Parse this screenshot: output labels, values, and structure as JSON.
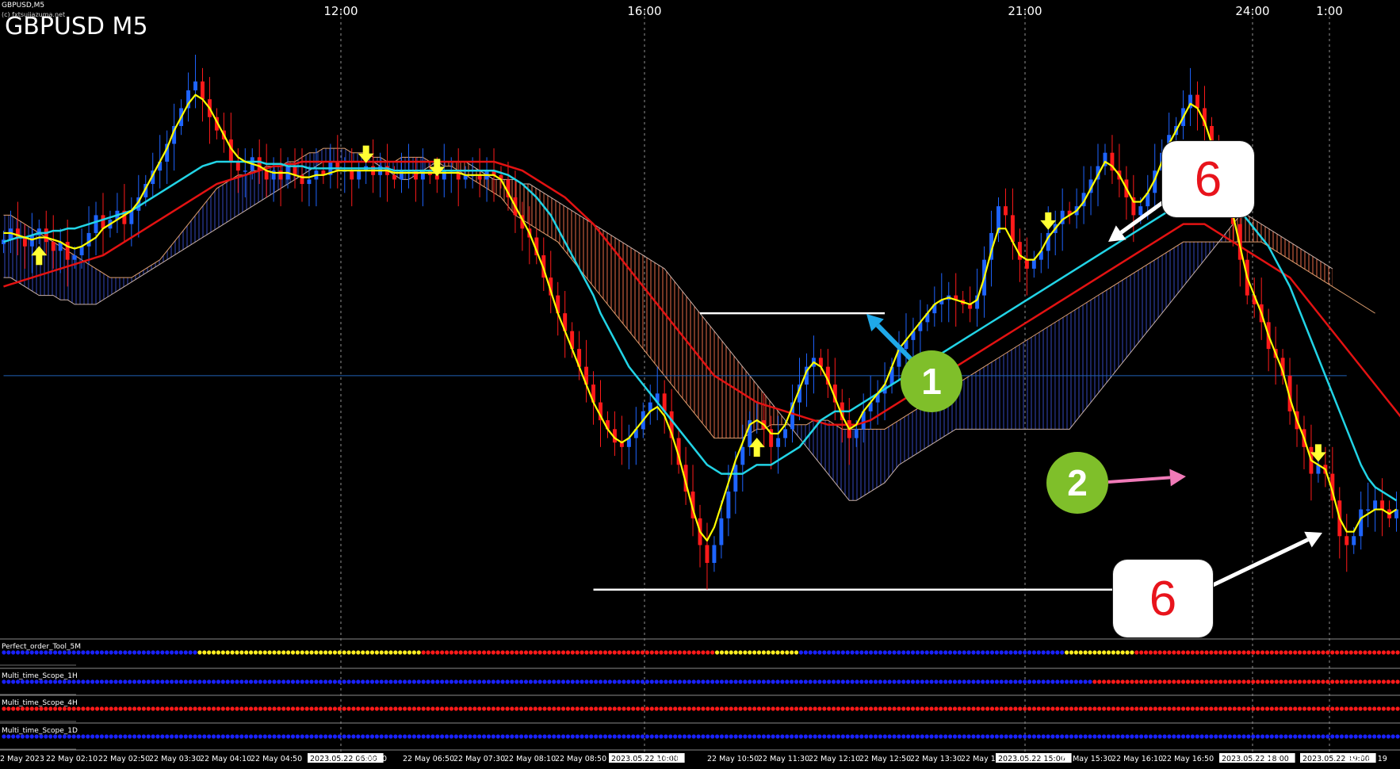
{
  "header": {
    "symbol_small": "GBPUSD,M5",
    "copyright": "(c) fxtsujiazuma.net",
    "title": "GBPUSD M5"
  },
  "time_axis_top": [
    "12:00",
    "16:00",
    "21:00",
    "24:00",
    "1:00"
  ],
  "time_axis_bottom": [
    "2 May 2023",
    "22 May 02:10",
    "22 May 02:50",
    "22 May 03:30",
    "22 May 04:10",
    "22 May 04:50",
    "2023.05.22 06:00",
    "y 06:10",
    "22 May 06:50",
    "22 May 07:30",
    "22 May 08:10",
    "22 May 08:50",
    "2023.05.22 10:00",
    "y 10:10",
    "22 May 10:50",
    "22 May 11:30",
    "22 May 12:10",
    "22 May 12:50",
    "22 May 13:30",
    "22 May 1",
    "2023.05.22 15:00",
    "22 May 15:30",
    "22 May 16:10",
    "22 May 16:50",
    "2023.05.22 18:00",
    "y 1",
    "2023.05.22 19:00",
    "22 May 19"
  ],
  "annotations": {
    "box_top": "6",
    "box_bottom": "6",
    "circle_1": "1",
    "circle_2": "2"
  },
  "subwindows": [
    {
      "name": "Perfect_order_Tool_5M",
      "dots": [
        [
          "blue",
          0.14
        ],
        [
          "yellow",
          0.16
        ],
        [
          "red",
          0.21
        ],
        [
          "yellow",
          0.06
        ],
        [
          "blue",
          0.19
        ],
        [
          "yellow",
          0.05
        ],
        [
          "red",
          0.19
        ]
      ]
    },
    {
      "name": "Multi_time_Scope_1H",
      "dots": [
        [
          "blue",
          0.78
        ],
        [
          "red",
          0.22
        ]
      ]
    },
    {
      "name": "Multi_time_Scope_4H",
      "dots": [
        [
          "red",
          1.0
        ]
      ]
    },
    {
      "name": "Multi_time_Scope_1D",
      "dots": [
        [
          "blue",
          1.0
        ]
      ]
    }
  ],
  "colors": {
    "background": "#000000",
    "bull_candle": "#1e64ff",
    "bear_candle": "#ff1a1a",
    "ma_fast": "#ffff00",
    "ma_mid": "#22d4e6",
    "ma_slow": "#e31212",
    "cloud_bull": "#2c3c9c",
    "cloud_bear": "#c05a3c",
    "signal_arrow": "#ffff33",
    "callout_red": "#e8141c",
    "callout_green": "#7fbf2a"
  },
  "chart_data": {
    "type": "candlestick",
    "symbol": "GBPUSD",
    "timeframe": "M5",
    "close": [
      30.5,
      33,
      31,
      29,
      31.5,
      33,
      30,
      28,
      30,
      26,
      27,
      29,
      32,
      36,
      33,
      35,
      37,
      34,
      37,
      40,
      43,
      46,
      48,
      52,
      56,
      60,
      64,
      66,
      62,
      58,
      55,
      53,
      48,
      46,
      46,
      49,
      46,
      44,
      46,
      44,
      47,
      45,
      43,
      44,
      46,
      45,
      48,
      46,
      46,
      44,
      46,
      47,
      45,
      47,
      45,
      44,
      46,
      46,
      44,
      46,
      45,
      44,
      46,
      46,
      44,
      45,
      45,
      44,
      46,
      45,
      44,
      40,
      36,
      33,
      31,
      27,
      22,
      18,
      14,
      10,
      6,
      2,
      -2,
      -6,
      -10,
      -12,
      -15,
      -16,
      -14,
      -12,
      -8,
      -6,
      -4,
      -8,
      -14,
      -20,
      -26,
      -32,
      -38,
      -42,
      -38,
      -32,
      -26,
      -20,
      -16,
      -10,
      -10,
      -12,
      -16,
      -14,
      -12,
      -6,
      -2,
      2,
      4,
      2,
      -2,
      -6,
      -10,
      -14,
      -12,
      -8,
      -6,
      -4,
      -2,
      2,
      6,
      8,
      10,
      12,
      14,
      16,
      17,
      18,
      17,
      16,
      15,
      18,
      26,
      32,
      38,
      36,
      30,
      26,
      24,
      26,
      28,
      32,
      34,
      37,
      36,
      38,
      41,
      44,
      47,
      50,
      46,
      44,
      40,
      36,
      38,
      41,
      46,
      50,
      54,
      56,
      60,
      63,
      60,
      56,
      50,
      44,
      40,
      34,
      26,
      18,
      16,
      12,
      6,
      4,
      0,
      -8,
      -12,
      -16,
      -22,
      -20,
      -22,
      -28,
      -36,
      -38,
      -36,
      -30,
      -30,
      -28,
      -30,
      -32,
      -30
    ],
    "ma_fast": [
      32,
      32,
      31.5,
      31,
      30.5,
      31,
      31,
      30.5,
      30,
      29,
      28.5,
      29,
      30,
      31,
      33,
      34,
      35,
      36,
      37,
      39,
      42,
      45,
      48,
      51,
      55,
      58,
      61,
      63,
      62,
      60,
      57,
      54,
      51,
      49,
      48,
      47.5,
      47,
      46,
      45.5,
      45.5,
      45.5,
      45,
      44.5,
      44.5,
      45,
      45,
      45.5,
      46,
      46,
      46,
      46,
      46,
      46,
      46,
      46,
      45.5,
      45.5,
      45.5,
      45.5,
      45.5,
      45.5,
      45.5,
      45.5,
      45.5,
      45.5,
      45,
      45,
      45,
      45,
      45,
      44,
      41,
      38,
      35,
      32,
      28,
      24,
      19,
      14,
      10,
      6,
      2,
      -2,
      -6,
      -9,
      -12,
      -14,
      -15,
      -14,
      -12,
      -10,
      -8,
      -7,
      -9,
      -13,
      -18,
      -24,
      -30,
      -35,
      -37,
      -34,
      -29,
      -24,
      -19,
      -15,
      -11,
      -10,
      -11,
      -13,
      -13,
      -11,
      -7,
      -3,
      1,
      3,
      2,
      -1,
      -5,
      -9,
      -12,
      -11,
      -8,
      -6,
      -4,
      -2,
      2,
      6,
      8,
      10,
      12,
      14,
      16,
      17,
      17.5,
      17,
      16.5,
      16,
      17,
      22,
      28,
      33,
      33,
      30,
      27,
      26,
      26,
      28,
      31,
      33,
      35,
      36,
      37,
      39,
      42,
      45,
      48,
      47,
      45,
      42,
      39,
      39,
      41,
      44,
      48,
      52,
      55,
      58,
      61,
      60,
      57,
      52,
      46,
      41,
      36,
      29,
      22,
      18,
      14,
      9,
      5,
      1,
      -5,
      -10,
      -14,
      -19,
      -20,
      -21,
      -26,
      -32,
      -35,
      -35,
      -32,
      -31,
      -30,
      -30,
      -31,
      -30
    ],
    "ma_mid": [
      30,
      30.5,
      31,
      31,
      31.5,
      32,
      32,
      32.5,
      32.5,
      33,
      33,
      33.5,
      34,
      34.5,
      35,
      35.5,
      36,
      36.5,
      37,
      38,
      39,
      40,
      41,
      42,
      43,
      44,
      45,
      46,
      47,
      47.5,
      48,
      48,
      48,
      48,
      48,
      48,
      48,
      47.5,
      47.5,
      47.5,
      47,
      47,
      47,
      46.5,
      46.5,
      46.5,
      46.5,
      46.5,
      46.5,
      46.5,
      46.5,
      46.5,
      46.5,
      46.5,
      46.5,
      46,
      46,
      46,
      46,
      46,
      46,
      46,
      46,
      46,
      46,
      46,
      46,
      46,
      46,
      46,
      45.5,
      45,
      44,
      43,
      41.5,
      40,
      38,
      36,
      33,
      30,
      27,
      24,
      21,
      18,
      14,
      11,
      8,
      5,
      2,
      0,
      -2,
      -4,
      -6,
      -8,
      -10,
      -12,
      -14,
      -16,
      -18,
      -20,
      -21,
      -22,
      -22,
      -22,
      -22,
      -21,
      -20,
      -20,
      -20,
      -19,
      -18,
      -17,
      -16,
      -14,
      -12,
      -10,
      -9,
      -8,
      -8,
      -8,
      -7,
      -6,
      -5,
      -4,
      -3,
      -2,
      -1,
      0,
      1,
      2,
      3,
      4,
      5,
      6,
      7,
      8,
      9,
      10,
      11,
      12,
      13,
      14,
      15,
      16,
      17,
      18,
      19,
      20,
      21,
      22,
      23,
      24,
      25,
      26,
      27,
      28,
      29,
      30,
      31,
      32,
      33,
      34,
      35,
      36,
      37,
      38,
      39,
      40,
      40.5,
      41,
      41,
      40.5,
      40,
      39,
      37,
      35,
      33,
      31,
      29,
      26,
      23,
      20,
      16,
      12,
      8,
      4,
      0,
      -4,
      -8,
      -12,
      -16,
      -20,
      -23,
      -25,
      -26,
      -27,
      -28
    ],
    "ma_slow": [
      20,
      20.5,
      21,
      21.5,
      22,
      22.5,
      23,
      23.5,
      24,
      24.5,
      25,
      25.5,
      26,
      26.5,
      27,
      28,
      29,
      30,
      31,
      32,
      33,
      34,
      35,
      36,
      37,
      38,
      39,
      40,
      41,
      42,
      43,
      43.5,
      44,
      44.5,
      45,
      45.5,
      46,
      46.5,
      47,
      47,
      47.5,
      47.5,
      48,
      48,
      48,
      48,
      48,
      48,
      48,
      48,
      48,
      48,
      48,
      48,
      48,
      48,
      48,
      48,
      48,
      48,
      48,
      48,
      48,
      48,
      48,
      48,
      48,
      48,
      48,
      48,
      47.5,
      47,
      46.5,
      46,
      45,
      44,
      43,
      42,
      41,
      40,
      38.5,
      37,
      35.5,
      34,
      32,
      30,
      28,
      26,
      24,
      22,
      20,
      18,
      16,
      14,
      12,
      10,
      8,
      6,
      4,
      2,
      0,
      -1,
      -2,
      -3,
      -4,
      -5,
      -6,
      -6.5,
      -7,
      -7.5,
      -8,
      -8.5,
      -9,
      -9.5,
      -10,
      -10.5,
      -11,
      -11,
      -11,
      -11,
      -11,
      -10.5,
      -10,
      -9,
      -8,
      -7,
      -6,
      -5,
      -4,
      -3,
      -2,
      -1,
      0,
      1,
      2,
      3,
      4,
      5,
      6,
      7,
      8,
      9,
      10,
      11,
      12,
      13,
      14,
      15,
      16,
      17,
      18,
      19,
      20,
      21,
      22,
      23,
      24,
      25,
      26,
      27,
      28,
      29,
      30,
      31,
      32,
      33,
      34,
      34,
      34,
      34,
      33,
      32,
      31,
      30,
      29,
      28,
      27,
      26,
      25,
      24,
      23,
      22,
      20,
      18,
      16,
      14,
      12,
      10,
      8,
      6,
      4,
      2,
      0,
      -2,
      -4,
      -6,
      -8,
      -10
    ],
    "cloud_a": [
      36,
      36,
      35,
      34,
      33,
      32,
      31,
      30,
      29,
      28,
      27,
      26,
      25,
      24,
      23,
      22,
      22,
      22,
      22,
      23,
      24,
      25,
      26,
      28,
      30,
      32,
      34,
      36,
      38,
      40,
      42,
      43,
      44,
      45,
      45,
      46,
      46,
      47,
      47,
      47,
      48,
      48,
      49,
      50,
      50,
      51,
      51,
      51,
      51,
      50,
      50,
      50,
      49,
      49,
      48,
      48,
      49,
      49,
      49,
      49,
      48,
      48,
      47,
      47,
      46,
      45,
      44,
      43,
      42,
      41,
      40,
      38,
      36,
      35,
      34,
      33,
      32,
      31,
      30,
      28,
      26,
      24,
      22,
      20,
      18,
      16,
      14,
      12,
      10,
      8,
      6,
      4,
      2,
      0,
      -2,
      -4,
      -6,
      -8,
      -10,
      -12,
      -14,
      -14,
      -14,
      -14,
      -14,
      -13,
      -12,
      -12,
      -11,
      -11,
      -11,
      -11,
      -11,
      -11,
      -10,
      -10,
      -10,
      -11,
      -12,
      -12,
      -12,
      -12,
      -12,
      -12,
      -12,
      -11,
      -10,
      -9,
      -8,
      -7,
      -6,
      -5,
      -4,
      -3,
      -2,
      -1,
      0,
      1,
      2,
      3,
      4,
      5,
      6,
      7,
      8,
      9,
      10,
      11,
      12,
      13,
      14,
      15,
      16,
      17,
      18,
      19,
      20,
      21,
      22,
      23,
      24,
      25,
      26,
      27,
      28,
      29,
      30,
      30,
      30,
      30,
      30,
      30,
      30,
      30,
      30,
      30,
      30,
      30,
      29,
      28,
      27,
      26,
      25,
      24,
      23,
      22,
      21,
      20,
      19,
      18,
      17,
      16,
      15,
      14
    ],
    "cloud_b": [
      22,
      22,
      21,
      20,
      19,
      18,
      18,
      18,
      17,
      17,
      16,
      16,
      16,
      16,
      17,
      18,
      19,
      20,
      21,
      22,
      23,
      24,
      25,
      26,
      27,
      28,
      29,
      30,
      31,
      32,
      33,
      34,
      35,
      36,
      37,
      38,
      39,
      40,
      41,
      42,
      43,
      44,
      45,
      46,
      47,
      48,
      48,
      48,
      48,
      48,
      48,
      48,
      48,
      47,
      46,
      45,
      44,
      44,
      45,
      46,
      47,
      48,
      48,
      48,
      48,
      48,
      47,
      46,
      45,
      44,
      44,
      44,
      44,
      43,
      43,
      42,
      41,
      40,
      39,
      38,
      37,
      36,
      35,
      34,
      33,
      32,
      31,
      30,
      29,
      28,
      27,
      26,
      25,
      24,
      22,
      20,
      18,
      16,
      14,
      12,
      10,
      8,
      6,
      4,
      2,
      0,
      -2,
      -4,
      -6,
      -8,
      -10,
      -12,
      -14,
      -16,
      -18,
      -20,
      -22,
      -24,
      -26,
      -28,
      -28,
      -27,
      -26,
      -25,
      -24,
      -22,
      -20,
      -19,
      -18,
      -17,
      -16,
      -15,
      -14,
      -13,
      -12,
      -12,
      -12,
      -12,
      -12,
      -12,
      -12,
      -12,
      -12,
      -12,
      -12,
      -12,
      -12,
      -12,
      -12,
      -12,
      -12,
      -10,
      -8,
      -6,
      -4,
      -2,
      0,
      2,
      4,
      6,
      8,
      10,
      12,
      14,
      16,
      18,
      20,
      22,
      24,
      26,
      28,
      30,
      32,
      34,
      36,
      36,
      35,
      34,
      33,
      32,
      31,
      30,
      29,
      28,
      27,
      26,
      25,
      24
    ],
    "signal_arrows": [
      {
        "index": 5,
        "direction": "up"
      },
      {
        "index": 51,
        "direction": "down"
      },
      {
        "index": 61,
        "direction": "down"
      },
      {
        "index": 106,
        "direction": "up"
      },
      {
        "index": 147,
        "direction": "down"
      },
      {
        "index": 185,
        "direction": "down"
      }
    ],
    "levels": [
      {
        "value": 14,
        "from": 98,
        "to": 124,
        "color": "#ffffff"
      },
      {
        "value": -48,
        "from": 83,
        "to": 168,
        "color": "#ffffff"
      },
      {
        "value": 0,
        "from": 0,
        "to": 189,
        "color": "#1f5fb5"
      }
    ],
    "ylim": [
      -58,
      80
    ]
  }
}
